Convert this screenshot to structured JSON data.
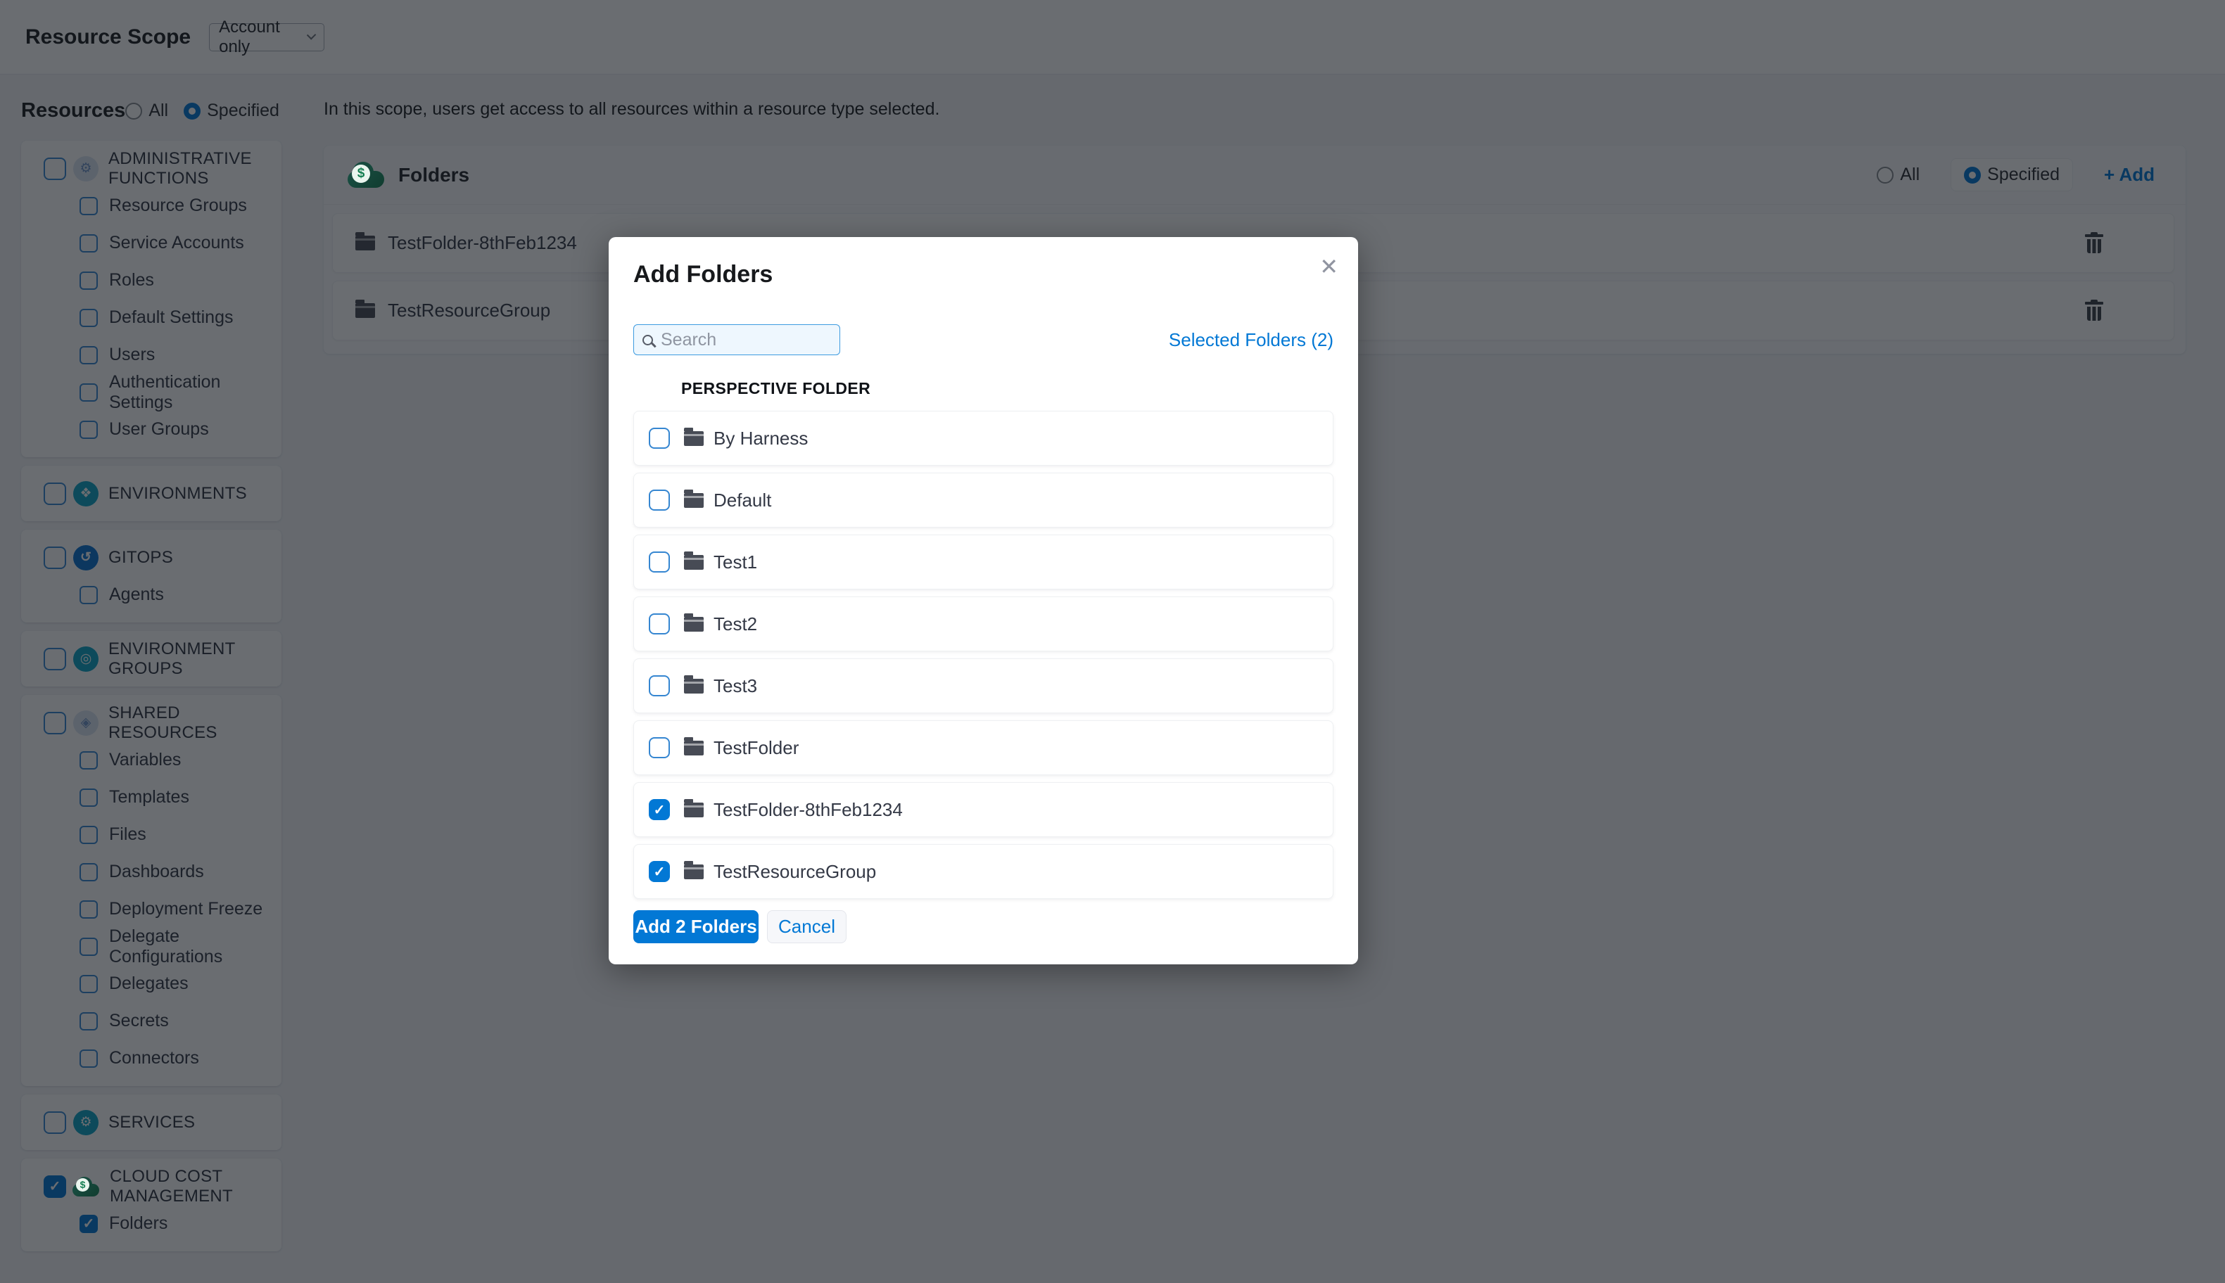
{
  "header": {
    "title": "Resource Scope",
    "scope_dropdown": {
      "value": "Account only"
    }
  },
  "sidebar": {
    "title": "Resources",
    "scope_all_label": "All",
    "scope_specified_label": "Specified",
    "scope_selected": "Specified",
    "groups": [
      {
        "label": "ADMINISTRATIVE FUNCTIONS",
        "icon": "gear-icon",
        "checked": false,
        "children": [
          {
            "label": "Resource Groups",
            "checked": false
          },
          {
            "label": "Service Accounts",
            "checked": false
          },
          {
            "label": "Roles",
            "checked": false
          },
          {
            "label": "Default Settings",
            "checked": false
          },
          {
            "label": "Users",
            "checked": false
          },
          {
            "label": "Authentication Settings",
            "checked": false
          },
          {
            "label": "User Groups",
            "checked": false
          }
        ]
      },
      {
        "label": "ENVIRONMENTS",
        "icon": "environments-icon",
        "checked": false,
        "children": []
      },
      {
        "label": "GITOPS",
        "icon": "gitops-icon",
        "checked": false,
        "children": [
          {
            "label": "Agents",
            "checked": false
          }
        ]
      },
      {
        "label": "ENVIRONMENT GROUPS",
        "icon": "environment-groups-icon",
        "checked": false,
        "children": []
      },
      {
        "label": "SHARED RESOURCES",
        "icon": "shared-resources-icon",
        "checked": false,
        "children": [
          {
            "label": "Variables",
            "checked": false
          },
          {
            "label": "Templates",
            "checked": false
          },
          {
            "label": "Files",
            "checked": false
          },
          {
            "label": "Dashboards",
            "checked": false
          },
          {
            "label": "Deployment Freeze",
            "checked": false
          },
          {
            "label": "Delegate Configurations",
            "checked": false
          },
          {
            "label": "Delegates",
            "checked": false
          },
          {
            "label": "Secrets",
            "checked": false
          },
          {
            "label": "Connectors",
            "checked": false
          }
        ]
      },
      {
        "label": "SERVICES",
        "icon": "services-icon",
        "checked": false,
        "children": []
      },
      {
        "label": "CLOUD COST MANAGEMENT",
        "icon": "cloud-cost-icon",
        "checked": true,
        "children": [
          {
            "label": "Folders",
            "checked": true
          }
        ]
      }
    ]
  },
  "main": {
    "description": "In this scope, users get access to all resources within a resource type selected.",
    "folders_card": {
      "title": "Folders",
      "all_label": "All",
      "specified_label": "Specified",
      "selected_option": "Specified",
      "add_label": "+ Add",
      "rows": [
        {
          "name": "TestFolder-8thFeb1234"
        },
        {
          "name": "TestResourceGroup"
        }
      ]
    }
  },
  "modal": {
    "title": "Add Folders",
    "search_placeholder": "Search",
    "selected_link": "Selected Folders (2)",
    "column_header": "PERSPECTIVE FOLDER",
    "rows": [
      {
        "label": "By Harness",
        "checked": false
      },
      {
        "label": "Default",
        "checked": false
      },
      {
        "label": "Test1",
        "checked": false
      },
      {
        "label": "Test2",
        "checked": false
      },
      {
        "label": "Test3",
        "checked": false
      },
      {
        "label": "TestFolder",
        "checked": false
      },
      {
        "label": "TestFolder-8thFeb1234",
        "checked": true
      },
      {
        "label": "TestResourceGroup",
        "checked": true
      }
    ],
    "primary_button": "Add 2 Folders",
    "cancel_button": "Cancel"
  },
  "icons": {
    "gear": "⚙",
    "environments": "❖",
    "gitops": "↺",
    "environment_groups": "◎",
    "shared": "◈",
    "services": "⚙",
    "dollar": "$",
    "close": "✕"
  },
  "colors": {
    "primary_blue": "#0278d5",
    "icon_teal": "#0ba3c4",
    "icon_blue": "#0a71d0",
    "ccm_green": "#1d8f63",
    "text_dark": "#1c1e21",
    "text_slate": "#343946"
  }
}
